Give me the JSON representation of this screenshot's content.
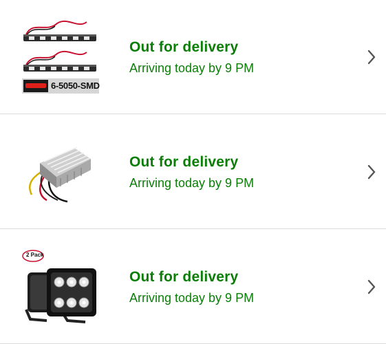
{
  "orders": [
    {
      "status": "Out for delivery",
      "eta": "Arriving today by 9 PM",
      "thumb_icon": "led-strip-icon",
      "thumb_caption": "6-5050-SMD"
    },
    {
      "status": "Out for delivery",
      "eta": "Arriving today by 9 PM",
      "thumb_icon": "voltage-converter-icon"
    },
    {
      "status": "Out for delivery",
      "eta": "Arriving today by 9 PM",
      "thumb_icon": "led-work-light-icon",
      "thumb_badge": "2 Pack"
    }
  ],
  "colors": {
    "status_green": "#0a7e07",
    "divider": "#dcdcdc",
    "chevron": "#555555"
  }
}
